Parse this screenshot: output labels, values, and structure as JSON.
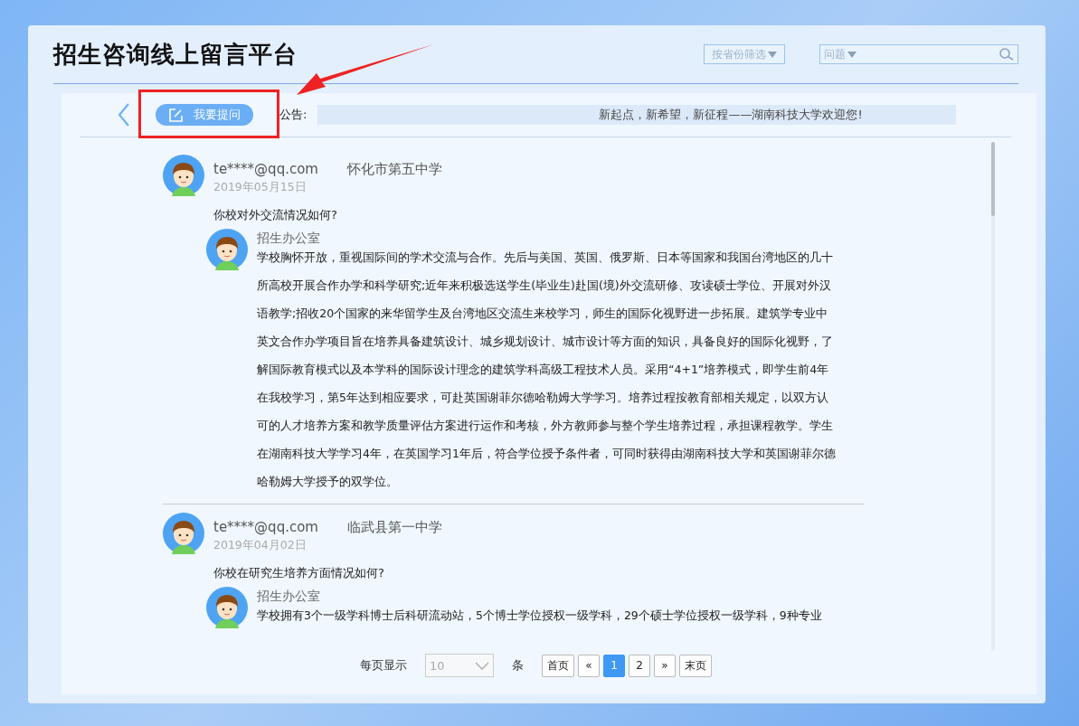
{
  "title": "招生咨询线上留言平台",
  "filters": {
    "province": "按省份筛选",
    "question": "问题"
  },
  "toolbar": {
    "ask_button": "我要提问",
    "notice_label": "公告:",
    "notice": "新起点，新希望，新征程——湖南科技大学欢迎您!"
  },
  "posts": [
    {
      "user": "te****@qq.com",
      "school": "怀化市第五中学",
      "date": "2019年05月15日",
      "question": "你校对外交流情况如何?",
      "reply_from": "招生办公室",
      "reply": "学校胸怀开放，重视国际间的学术交流与合作。先后与美国、英国、俄罗斯、日本等国家和我国台湾地区的几十所高校开展合作办学和科学研究;近年来积极选送学生(毕业生)赴国(境)外交流研修、攻读硕士学位、开展对外汉语教学;招收20个国家的来华留学生及台湾地区交流生来校学习，师生的国际化视野进一步拓展。建筑学专业中英文合作办学项目旨在培养具备建筑设计、城乡规划设计、城市设计等方面的知识，具备良好的国际化视野，了解国际教育模式以及本学科的国际设计理念的建筑学科高级工程技术人员。采用“4+1”培养模式，即学生前4年在我校学习，第5年达到相应要求，可赴英国谢菲尔德哈勒姆大学学习。培养过程按教育部相关规定，以双方认可的人才培养方案和教学质量评估方案进行运作和考核，外方教师参与整个学生培养过程，承担课程教学。学生在湖南科技大学学习4年，在英国学习1年后，符合学位授予条件者，可同时获得由湖南科技大学和英国谢菲尔德哈勒姆大学授予的双学位。"
    },
    {
      "user": "te****@qq.com",
      "school": "临武县第一中学",
      "date": "2019年04月02日",
      "question": "你校在研究生培养方面情况如何?",
      "reply_from": "招生办公室",
      "reply": "学校拥有3个一级学科博士后科研流动站，5个博士学位授权一级学科，29个硕士学位授权一级学科，9种专业"
    }
  ],
  "pagination": {
    "per_page_label": "每页显示",
    "per_page": "10",
    "unit": "条",
    "first": "首页",
    "prev": "«",
    "pages": [
      {
        "label": "1",
        "selected": true
      },
      {
        "label": "2",
        "selected": false
      }
    ],
    "next": "»",
    "last": "末页"
  }
}
